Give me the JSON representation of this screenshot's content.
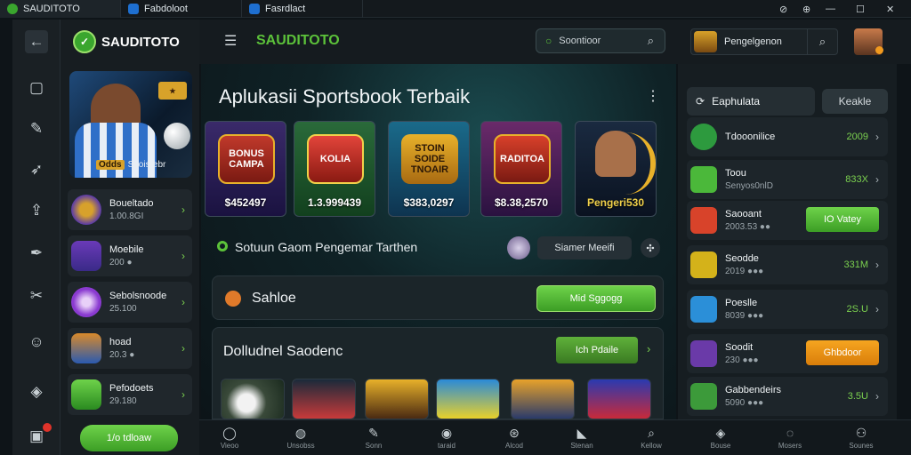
{
  "titlebar": {
    "tabs": [
      {
        "label": "SAUDITOTO",
        "color": "#3aa62e"
      },
      {
        "label": "Fabdoloot",
        "color": "#1e6fd0"
      },
      {
        "label": "Fasrdlact",
        "color": "#1e6fd0"
      }
    ],
    "controls": [
      "⊘",
      "⊕",
      "—",
      "☐",
      "✕"
    ]
  },
  "rail": {
    "icons": [
      "back-arrow",
      "chat",
      "edit",
      "rocket",
      "share",
      "pen",
      "tools",
      "smile",
      "cube",
      "gift"
    ]
  },
  "leftpanel": {
    "brand": "SAUDITOTO",
    "hero_badge": "Odds",
    "hero_caption": "Saoisrebr",
    "items": [
      {
        "title": "Boueltado",
        "sub": "1.00.8GI"
      },
      {
        "title": "Moebile",
        "sub": "200 ●"
      },
      {
        "title": "Sebolsnoode",
        "sub": "25.100"
      },
      {
        "title": "hoad",
        "sub": "20.3 ●"
      },
      {
        "title": "Pefodoets",
        "sub": "29.180"
      }
    ],
    "cta": "1/o tdloaw"
  },
  "header": {
    "title": "SAUDITOTO",
    "search_placeholder": "Soontioor",
    "account_label": "Pengelgenon"
  },
  "main": {
    "heading": "Aplukasii Sportsbook Terbaik",
    "games": [
      {
        "label": "BONUS CAMPA",
        "price": "$452497"
      },
      {
        "label": "KOLIA",
        "price": "1.3.999439"
      },
      {
        "label": "STOIN SOIDE TNOAIR",
        "price": "$383,0297"
      },
      {
        "label": "RADITOA",
        "price": "$8.38,2570"
      },
      {
        "label": "",
        "price": "Pengeri530"
      }
    ],
    "status_text": "Sotuun Gaom Pengemar Tarthen",
    "user_chip": "Siamer Meeifi",
    "panel1_title": "Sahloe",
    "panel1_button": "Mid Sggogg",
    "panel2_title": "Dolludnel Saodenc",
    "panel2_button": "Ich Pdaile"
  },
  "rightpanel": {
    "tab_active": "Eaphulata",
    "tab_inactive": "Keakle",
    "items": [
      {
        "title": "Tdooonilice",
        "sub": "",
        "value": "2009",
        "color": "#2d9a3e"
      },
      {
        "title": "Toou",
        "sub": "Senyos0nlD",
        "value": "833X",
        "color": "#4bb83a"
      },
      {
        "title": "Saooant",
        "sub": "2003.53 ●●",
        "button": "IO Vatey",
        "color": "#d8432a"
      },
      {
        "title": "Seodde",
        "sub": "2019 ●●●",
        "value": "331M",
        "color": "#d4b21a"
      },
      {
        "title": "Poeslle",
        "sub": "8039 ●●●",
        "value": "2S.U",
        "color": "#2b8fd8"
      },
      {
        "title": "Soodit",
        "sub": "230 ●●●",
        "button": "Ghbdoor",
        "color": "#6a3aa8"
      },
      {
        "title": "Gabbendeirs",
        "sub": "5090 ●●●",
        "value": "3.5U",
        "color": "#3c9a3a"
      }
    ]
  },
  "bottomnav": {
    "items": [
      "Vieoo",
      "Unsobss",
      "Sonn",
      "taraid",
      "Alcod",
      "Stenan",
      "Kellow",
      "Bouse",
      "Mosers",
      "Sounes"
    ]
  }
}
